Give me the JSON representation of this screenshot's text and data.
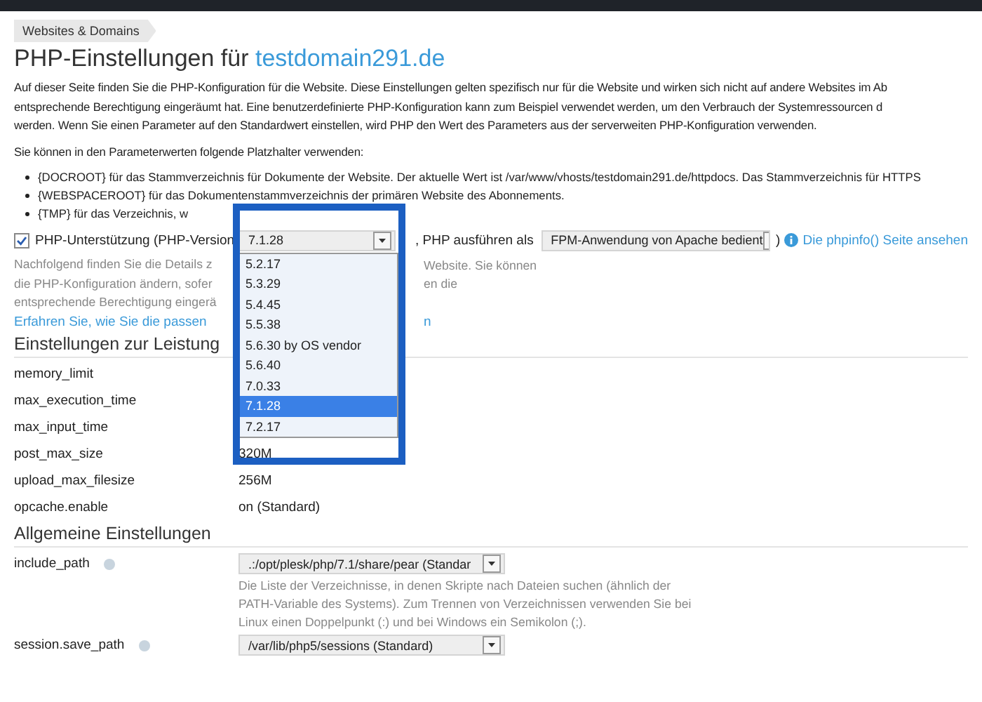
{
  "breadcrumb": "Websites & Domains",
  "title": {
    "text": "PHP-Einstellungen für",
    "domain": "testdomain291.de"
  },
  "intro_lines": [
    "Auf dieser Seite finden Sie die PHP-Konfiguration für die Website. Diese Einstellungen gelten spezifisch nur für die Website und wirken sich nicht auf andere Websites im Ab",
    "entsprechende Berechtigung eingeräumt hat. Eine benutzerdefinierte PHP-Konfiguration kann zum Beispiel verwendet werden, um den Verbrauch der Systemressourcen d",
    "werden. Wenn Sie einen Parameter auf den Standardwert einstellen, wird PHP den Wert des Parameters aus der serverweiten PHP-Konfiguration verwenden."
  ],
  "placeholder_intro": "Sie können in den Parameterwerten folgende Platzhalter verwenden:",
  "placeholders": [
    "{DOCROOT} für das Stammverzeichnis für Dokumente der Website. Der aktuelle Wert ist /var/www/vhosts/testdomain291.de/httpdocs. Das Stammverzeichnis für HTTPS",
    "{WEBSPACEROOT} für das Dokumentenstammverzeichnis der primären Website des Abonnements.",
    "{TMP} für das Verzeichnis, w"
  ],
  "php_support": {
    "checked": true,
    "label": "PHP-Unterstützung (PHP-Version",
    "version": "7.1.28",
    "run_as_label": ", PHP ausführen als",
    "handler": "FPM-Anwendung von Apache bedient",
    "close": ")",
    "phpinfo_link": "Die phpinfo() Seite ansehen"
  },
  "version_dropdown": {
    "options": [
      {
        "label": "5.2.17",
        "selected": false
      },
      {
        "label": "5.3.29",
        "selected": false
      },
      {
        "label": "5.4.45",
        "selected": false
      },
      {
        "label": "5.5.38",
        "selected": false
      },
      {
        "label": "5.6.30 by OS vendor",
        "selected": false
      },
      {
        "label": "5.6.40",
        "selected": false
      },
      {
        "label": "7.0.33",
        "selected": false
      },
      {
        "label": "7.1.28",
        "selected": true
      },
      {
        "label": "7.2.17",
        "selected": false
      }
    ]
  },
  "note_lines": [
    {
      "left": "Nachfolgend finden Sie die Details z",
      "right": "Website. Sie können"
    },
    {
      "left": "die PHP-Konfiguration ändern, sofer",
      "right": "en die"
    },
    {
      "left": "entsprechende Berechtigung eingerä"
    }
  ],
  "learn_link": {
    "left": "Erfahren Sie, wie Sie die passen",
    "right": "n"
  },
  "performance": {
    "heading": "Einstellungen zur Leistung",
    "rows": [
      {
        "name": "memory_limit"
      },
      {
        "name": "max_execution_time"
      },
      {
        "name": "max_input_time"
      },
      {
        "name": "post_max_size",
        "value": "320M"
      },
      {
        "name": "upload_max_filesize",
        "value": "256M"
      },
      {
        "name": "opcache.enable",
        "value": "on (Standard)"
      }
    ]
  },
  "general": {
    "heading": "Allgemeine Einstellungen",
    "rows": [
      {
        "name": "include_path",
        "help": true,
        "value": ".:/opt/plesk/php/7.1/share/pear (Standar",
        "description_lines": [
          "Die Liste der Verzeichnisse, in denen Skripte nach Dateien suchen (ähnlich der",
          "PATH-Variable des Systems). Zum Trennen von Verzeichnissen verwenden Sie bei",
          "Linux einen Doppelpunkt (:) und bei Windows ein Semikolon (;)."
        ]
      },
      {
        "name": "session.save_path",
        "help": true,
        "value": "/var/lib/php5/sessions (Standard)"
      }
    ]
  }
}
